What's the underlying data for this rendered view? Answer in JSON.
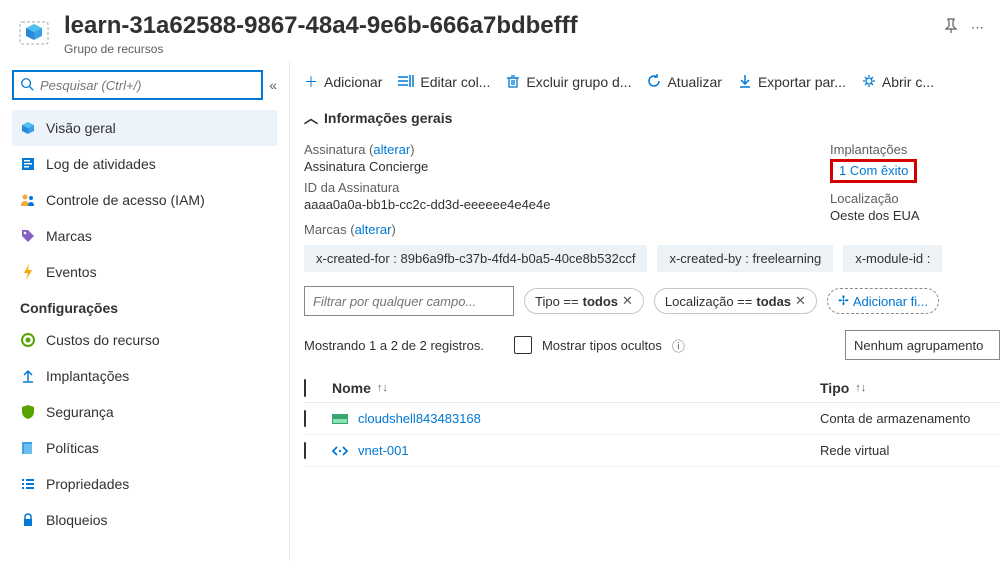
{
  "header": {
    "title": "learn-31a62588-9867-48a4-9e6b-666a7bdbefff",
    "subtitle": "Grupo de recursos"
  },
  "search": {
    "placeholder": "Pesquisar (Ctrl+/)"
  },
  "nav": {
    "items": [
      {
        "key": "overview",
        "label": "Visão geral",
        "icon": "cube",
        "active": true
      },
      {
        "key": "activity",
        "label": "Log de atividades",
        "icon": "log"
      },
      {
        "key": "iam",
        "label": "Controle de acesso (IAM)",
        "icon": "iam"
      },
      {
        "key": "tags",
        "label": "Marcas",
        "icon": "tag"
      },
      {
        "key": "events",
        "label": "Eventos",
        "icon": "bolt"
      }
    ],
    "settings_section": "Configurações",
    "settings": [
      {
        "key": "costs",
        "label": "Custos do recurso",
        "icon": "cost"
      },
      {
        "key": "deployments",
        "label": "Implantações",
        "icon": "deploy"
      },
      {
        "key": "security",
        "label": "Segurança",
        "icon": "shield"
      },
      {
        "key": "policies",
        "label": "Políticas",
        "icon": "policy"
      },
      {
        "key": "properties",
        "label": "Propriedades",
        "icon": "props"
      },
      {
        "key": "locks",
        "label": "Bloqueios",
        "icon": "lock"
      }
    ]
  },
  "toolbar": {
    "add": "Adicionar",
    "edit_cols": "Editar col...",
    "delete_rg": "Excluir grupo d...",
    "refresh": "Atualizar",
    "export": "Exportar par...",
    "open": "Abrir c..."
  },
  "essentials": {
    "header": "Informações gerais",
    "subscription_label": "Assinatura",
    "change_link": "alterar",
    "subscription_value": "Assinatura Concierge",
    "subid_label": "ID da Assinatura",
    "subid_value": "aaaa0a0a-bb1b-cc2c-dd3d-eeeeee4e4e4e",
    "tags_label": "Marcas",
    "deployments_label": "Implantações",
    "deployments_value": "1 Com êxito",
    "location_label": "Localização",
    "location_value": "Oeste dos EUA",
    "tags": [
      "x-created-for : 89b6a9fb-c37b-4fd4-b0a5-40ce8b532ccf",
      "x-created-by : freelearning",
      "x-module-id :"
    ]
  },
  "filters": {
    "placeholder": "Filtrar por qualquer campo...",
    "type_pill_prefix": "Tipo == ",
    "type_pill_value": "todos",
    "loc_pill_prefix": "Localização == ",
    "loc_pill_value": "todas",
    "add_filter": "Adicionar fi..."
  },
  "status": {
    "count_text": "Mostrando 1 a 2 de 2 registros.",
    "show_hidden": "Mostrar tipos ocultos",
    "group_none": "Nenhum agrupamento"
  },
  "table": {
    "name_header": "Nome",
    "type_header": "Tipo",
    "rows": [
      {
        "name": "cloudshell843483168",
        "type": "Conta de armazenamento",
        "icon": "storage"
      },
      {
        "name": "vnet-001",
        "type": "Rede virtual",
        "icon": "vnet"
      }
    ]
  }
}
